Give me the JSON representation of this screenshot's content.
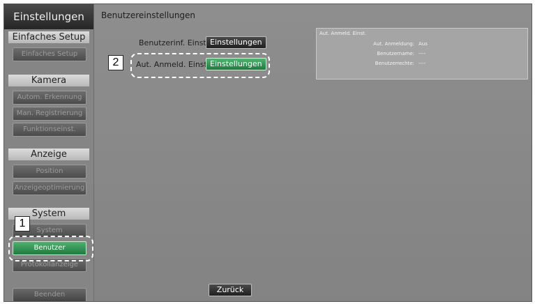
{
  "sidebar": {
    "title": "Einstellungen",
    "sections": [
      {
        "heading": "Einfaches Setup",
        "items": [
          "Einfaches Setup"
        ]
      },
      {
        "heading": "Kamera",
        "items": [
          "Autom. Erkennung",
          "Man. Registrierung",
          "Funktionseinst."
        ]
      },
      {
        "heading": "Anzeige",
        "items": [
          "Position",
          "Anzeigeoptimierung"
        ]
      },
      {
        "heading": "System",
        "items": [
          "System",
          "Benutzer",
          "Protokollanzeige"
        ]
      }
    ],
    "active_item": "Benutzer",
    "exit_label": "Beenden"
  },
  "main": {
    "title": "Benutzereinstellungen",
    "rows": [
      {
        "label": "Benutzerinf. Einst.",
        "button": "Einstellungen"
      },
      {
        "label": "Aut. Anmeld. Einst.",
        "button": "Einstellungen"
      }
    ],
    "back_label": "Zurück"
  },
  "info_panel": {
    "title": "Aut. Anmeld. Einst.",
    "rows": [
      {
        "key": "Aut. Anmeldung:",
        "value": "Aus"
      },
      {
        "key": "Benutzername:",
        "value": "----"
      },
      {
        "key": "Benutzerrechte:",
        "value": "----"
      }
    ]
  },
  "callouts": [
    "1",
    "2"
  ],
  "colors": {
    "accent_green": "#2e8f4e",
    "dashed_highlight": "#ffffff"
  }
}
